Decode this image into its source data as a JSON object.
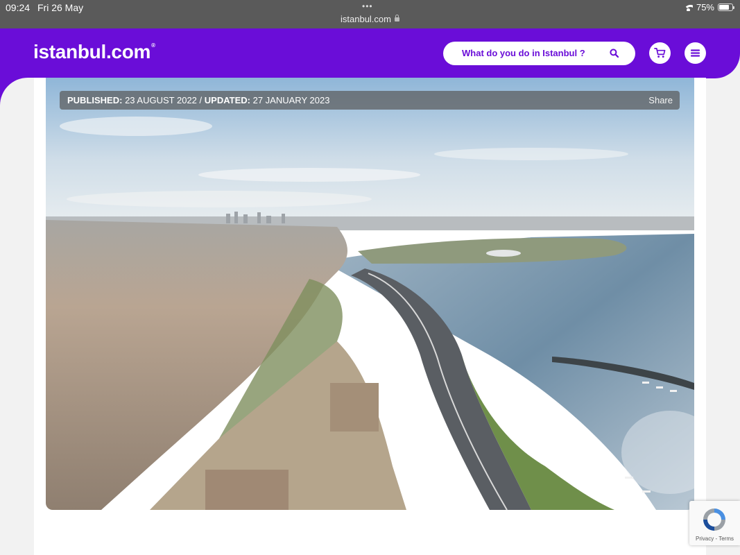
{
  "status_bar": {
    "time": "09:24",
    "date": "Fri 26 May",
    "tab_dots": "•••",
    "url": "istanbul.com",
    "battery": "75%",
    "battery_level": 0.75
  },
  "header": {
    "logo": "istanbul.com",
    "logo_mark": "®",
    "search_placeholder": "What do you do in Istanbul ?",
    "brand_color": "#6a0dd8"
  },
  "article": {
    "published_label": "PUBLISHED:",
    "published_date": "23 AUGUST 2022",
    "separator": "/",
    "updated_label": "UPDATED:",
    "updated_date": "27 JANUARY 2023",
    "share_label": "Share"
  },
  "recaptcha": {
    "links": "Privacy - Terms"
  }
}
